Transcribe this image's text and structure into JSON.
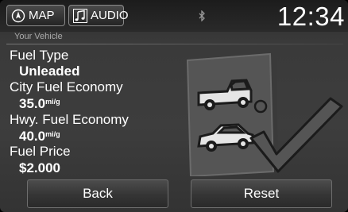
{
  "topbar": {
    "map_label": "MAP",
    "audio_label": "AUDIO",
    "clock": "12:34",
    "map_icon": "compass-icon",
    "audio_icon": "music-note-icon",
    "status_icon": "bluetooth-icon"
  },
  "section": {
    "title": "Your Vehicle"
  },
  "fields": {
    "fuel_type": {
      "label": "Fuel Type",
      "value": "Unleaded"
    },
    "city": {
      "label": "City Fuel Economy",
      "value": "35.0",
      "unit": "mi/g"
    },
    "hwy": {
      "label": "Hwy. Fuel Economy",
      "value": "40.0",
      "unit": "mi/g"
    },
    "price": {
      "label": "Fuel Price",
      "value": "$2.000"
    }
  },
  "buttons": {
    "back": "Back",
    "reset": "Reset"
  },
  "illustration": {
    "icon": "vehicle-selection-checkmark-icon"
  }
}
